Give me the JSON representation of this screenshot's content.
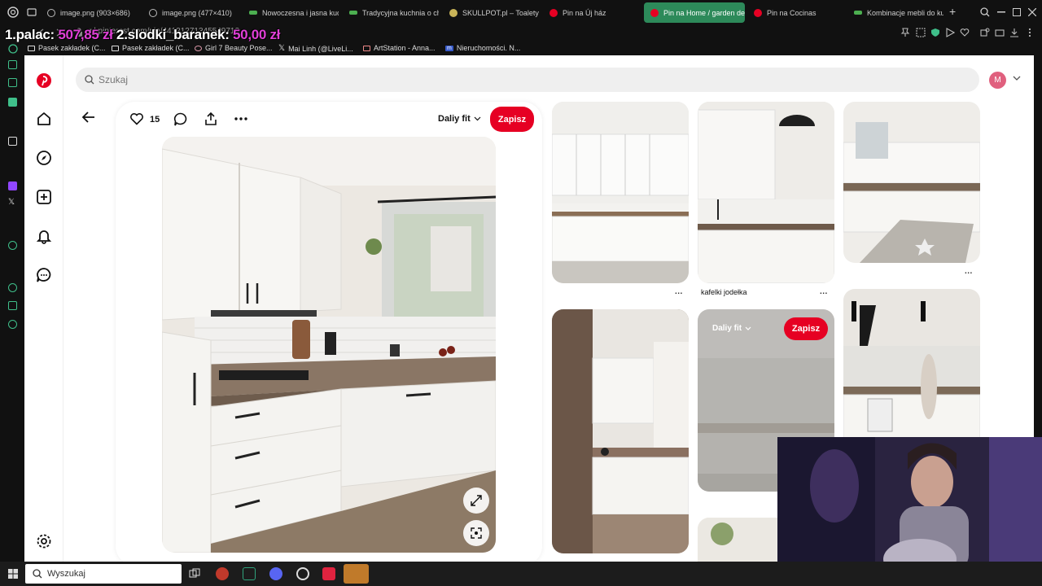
{
  "browser": {
    "tabs": [
      {
        "label": "image.png (903×686)",
        "active": false
      },
      {
        "label": "image.png (477×410)",
        "active": false
      },
      {
        "label": "Nowoczesna i jasna kuc",
        "active": false
      },
      {
        "label": "Tradycyjna kuchnia o ch",
        "active": false
      },
      {
        "label": "SKULLPOT.pl – Toalety",
        "active": false
      },
      {
        "label": "Pin na Új ház",
        "active": false
      },
      {
        "label": "Pin na Home / garden de",
        "active": true
      },
      {
        "label": "Pin na Cocinas",
        "active": false
      },
      {
        "label": "Kombinacje mebli do ku",
        "active": false
      }
    ],
    "new_tab": "+",
    "url": "pl.pinterest.com/pin/44121271345549712",
    "bookmarks": [
      {
        "label": "Pasek zakładek (C..."
      },
      {
        "label": "Pasek zakładek (C..."
      },
      {
        "label": "Girl 7 Beauty Pose..."
      },
      {
        "label": "Mai Linh (@LiveLi..."
      },
      {
        "label": "ArtStation - Anna..."
      },
      {
        "label": "Nieruchomości. N..."
      }
    ]
  },
  "overlay": {
    "first_rank": "1.palac:",
    "first_amount": "507,85 zł",
    "second_rank": "2.slodki_baranek:",
    "second_amount": "50,00 zł"
  },
  "pinterest": {
    "search_placeholder": "Szukaj",
    "avatar_letter": "M",
    "pin": {
      "like_count": "15",
      "board": "Daliy fit",
      "save_label": "Zapisz"
    },
    "grid": {
      "caption_2": "kafelki jodełka",
      "hover_board": "Daliy fit",
      "hover_save": "Zapisz",
      "more": "..."
    }
  },
  "taskbar": {
    "search_placeholder": "Wyszukaj"
  },
  "colors": {
    "pinterest_red": "#e60023",
    "tab_active": "#2d8a5a",
    "overlay_amount": "#e040d6"
  }
}
